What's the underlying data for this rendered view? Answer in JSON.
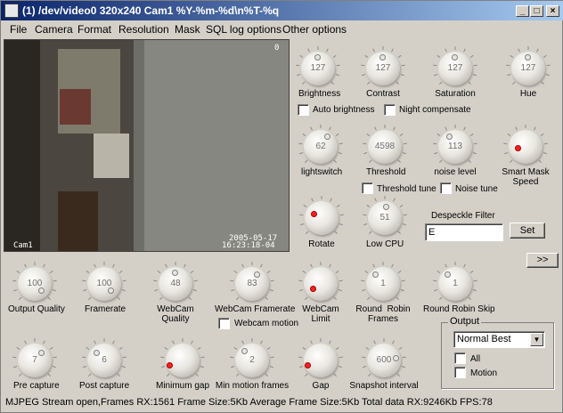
{
  "window": {
    "title": "(1) /dev/video0 320x240 Cam1 %Y-%m-%d\\n%T-%q",
    "minimize": "_",
    "maximize": "□",
    "close": "×"
  },
  "menu": [
    "File",
    "Camera",
    "Format",
    "Resolution",
    "Mask",
    "SQL log options",
    "Other options"
  ],
  "video": {
    "corner_number": "0",
    "camera_label": "Cam1",
    "date": "2005-05-17",
    "time": "16:23:18-04"
  },
  "knobs": {
    "brightness": {
      "label": "Brightness",
      "value": "127"
    },
    "contrast": {
      "label": "Contrast",
      "value": "127"
    },
    "saturation": {
      "label": "Saturation",
      "value": "127"
    },
    "hue": {
      "label": "Hue",
      "value": "127"
    },
    "lightswitch": {
      "label": "lightswitch",
      "value": "62"
    },
    "threshold": {
      "label": "Threshold",
      "value": "4598"
    },
    "noise_level": {
      "label": "noise level",
      "value": "113"
    },
    "smart_mask_speed": {
      "label": "Smart Mask\nSpeed",
      "value": ""
    },
    "rotate": {
      "label": "Rotate",
      "value": ""
    },
    "low_cpu": {
      "label": "Low CPU",
      "value": "51"
    },
    "output_quality": {
      "label": "Output Quality",
      "value": "100"
    },
    "framerate": {
      "label": "Framerate",
      "value": "100"
    },
    "webcam_quality": {
      "label": "WebCam\nQuality",
      "value": "48"
    },
    "webcam_framerate": {
      "label": "WebCam Framerate",
      "value": "83"
    },
    "webcam_limit": {
      "label": "WebCam\nLimit",
      "value": ""
    },
    "round_robin_frames": {
      "label": "Round  Robin\nFrames",
      "value": "1"
    },
    "round_robin_skip": {
      "label": "Round Robin Skip",
      "value": "1"
    },
    "pre_capture": {
      "label": "Pre capture",
      "value": "7"
    },
    "post_capture": {
      "label": "Post capture",
      "value": "6"
    },
    "minimum_gap": {
      "label": "Minimum gap",
      "value": ""
    },
    "min_motion_frames": {
      "label": "Min motion frames",
      "value": "2"
    },
    "gap": {
      "label": "Gap",
      "value": ""
    },
    "snapshot_interval": {
      "label": "Snapshot interval",
      "value": "600"
    }
  },
  "checkboxes": {
    "auto_brightness": "Auto brightness",
    "night_compensate": "Night compensate",
    "threshold_tune": "Threshold tune",
    "noise_tune": "Noise tune",
    "webcam_motion": "Webcam motion",
    "all": "All",
    "motion": "Motion"
  },
  "despeckle": {
    "label": "Despeckle Filter",
    "value": "E",
    "set_button": "Set"
  },
  "more_button": ">>",
  "output": {
    "title": "Output",
    "selected": "Normal Best"
  },
  "status": "MJPEG Stream open,Frames RX:1561 Frame Size:5Kb Average Frame Size:5Kb Total data RX:9246Kb FPS:78"
}
